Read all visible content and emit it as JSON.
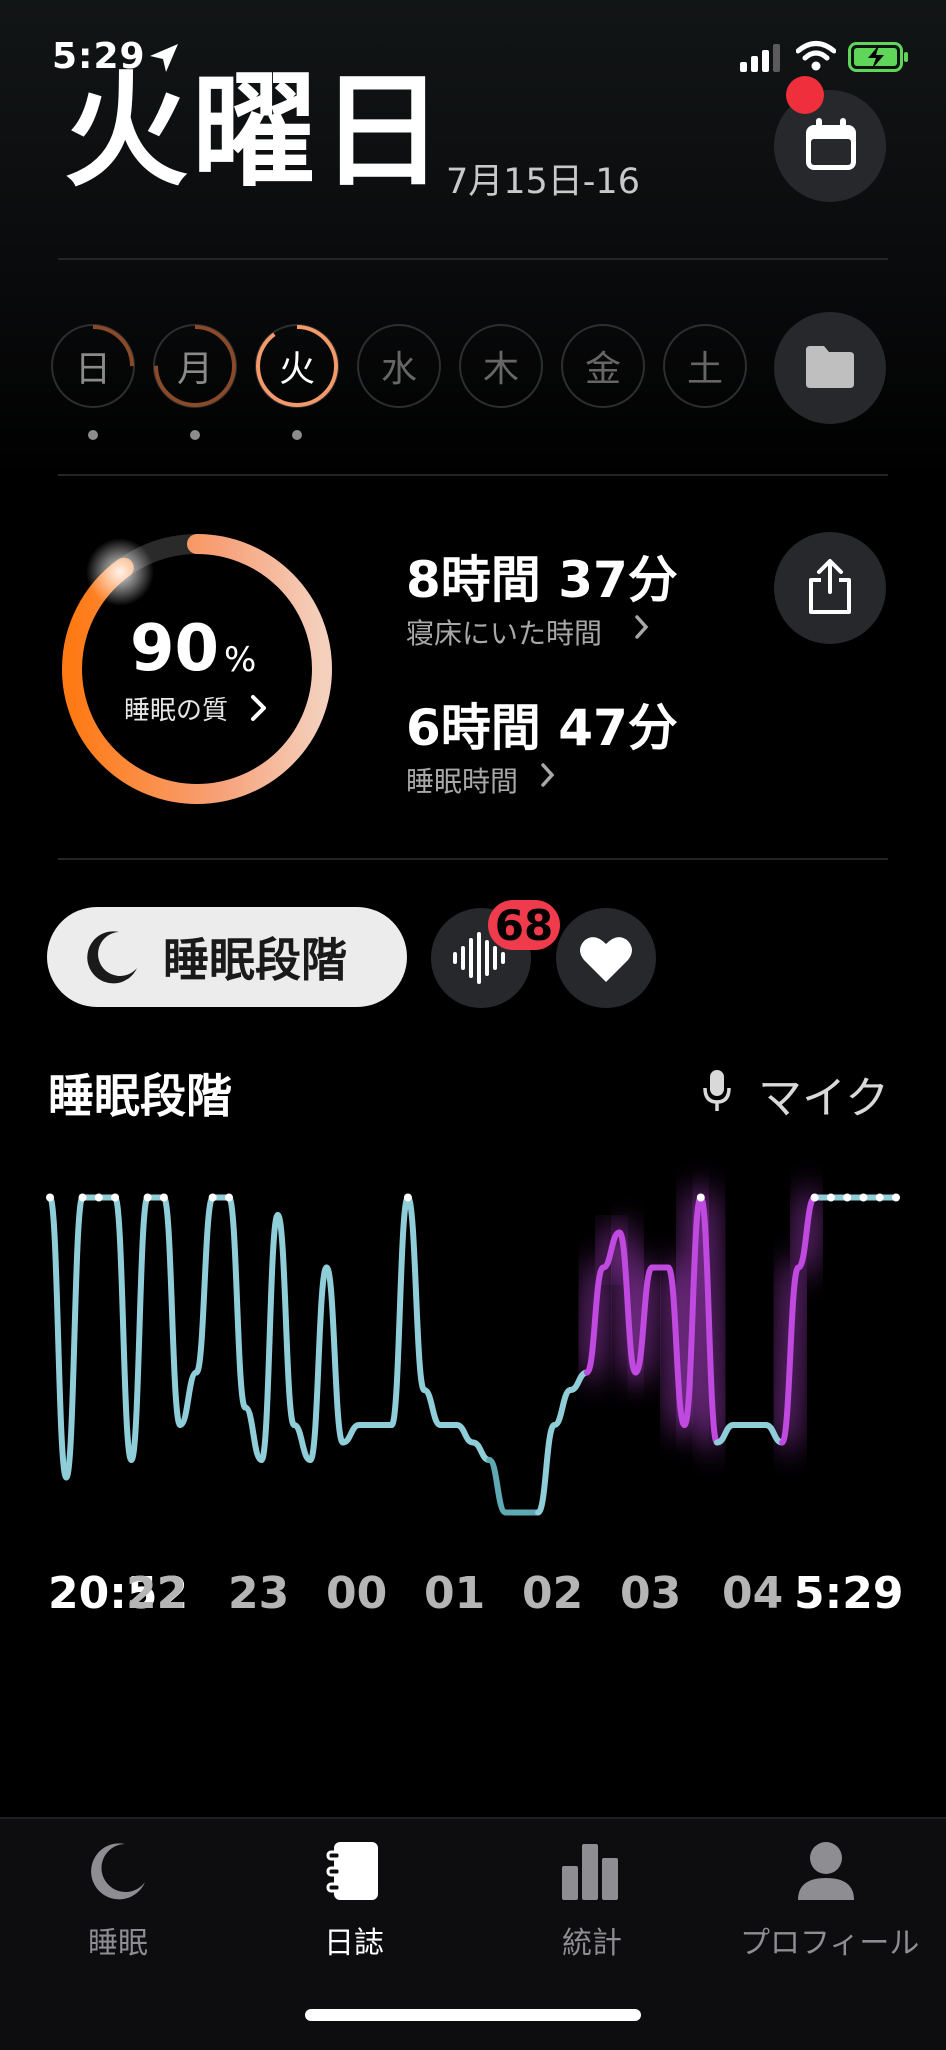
{
  "status_bar": {
    "time": "5:29"
  },
  "header": {
    "weekday": "火曜日",
    "date_range": "7月15日-16"
  },
  "week": {
    "days": [
      {
        "label": "日",
        "progress": 0.25,
        "dot": true
      },
      {
        "label": "月",
        "progress": 0.75,
        "dot": true
      },
      {
        "label": "火",
        "progress": 0.9,
        "dot": true
      },
      {
        "label": "水",
        "progress": 0,
        "dot": false
      },
      {
        "label": "木",
        "progress": 0,
        "dot": false
      },
      {
        "label": "金",
        "progress": 0,
        "dot": false
      },
      {
        "label": "土",
        "progress": 0,
        "dot": false
      }
    ],
    "selected": 2
  },
  "summary": {
    "quality_value": "90",
    "quality_unit": "%",
    "quality_label": "睡眠の質",
    "quality_fraction": 0.9,
    "time_in_bed": "8時間 37分",
    "time_in_bed_label": "寝床にいた時間",
    "sleep_time": "6時間 47分",
    "sleep_time_label": "睡眠時間"
  },
  "tabs": {
    "sleep_stage_label": "睡眠段階",
    "sound_badge": "68"
  },
  "chart": {
    "title": "睡眠段階",
    "mic_label": "マイク"
  },
  "chart_data": {
    "type": "line",
    "x": [
      "20:52",
      "21:00",
      "21:10",
      "21:20",
      "21:30",
      "21:40",
      "21:50",
      "22:00",
      "22:10",
      "22:20",
      "22:30",
      "22:40",
      "22:50",
      "23:00",
      "23:10",
      "23:20",
      "23:30",
      "23:40",
      "23:50",
      "00:00",
      "00:10",
      "00:20",
      "00:30",
      "00:40",
      "00:50",
      "01:00",
      "01:10",
      "01:20",
      "01:30",
      "01:40",
      "01:50",
      "02:00",
      "02:10",
      "02:20",
      "02:30",
      "02:40",
      "02:50",
      "03:00",
      "03:10",
      "03:20",
      "03:30",
      "03:40",
      "03:50",
      "04:00",
      "04:10",
      "04:20",
      "04:30",
      "04:40",
      "04:50",
      "05:00",
      "05:10",
      "05:20",
      "05:29"
    ],
    "y": [
      0.95,
      0.15,
      0.95,
      0.95,
      0.95,
      0.2,
      0.95,
      0.95,
      0.3,
      0.45,
      0.95,
      0.95,
      0.35,
      0.2,
      0.9,
      0.3,
      0.2,
      0.75,
      0.25,
      0.3,
      0.3,
      0.3,
      0.95,
      0.4,
      0.3,
      0.3,
      0.25,
      0.2,
      0.05,
      0.05,
      0.05,
      0.3,
      0.4,
      0.45,
      0.75,
      0.85,
      0.45,
      0.75,
      0.75,
      0.3,
      0.95,
      0.25,
      0.3,
      0.3,
      0.3,
      0.25,
      0.75,
      0.95,
      0.95,
      0.95,
      0.95,
      0.95,
      0.95
    ],
    "x_ticks": [
      "20:52",
      "22",
      "23",
      "00",
      "01",
      "02",
      "03",
      "04",
      "5:29"
    ],
    "colors": {
      "deep": "#5fa9b4",
      "light": "#8fcdd8",
      "rem": "#c04adf",
      "awake": "#ffffff"
    }
  },
  "tabbar": {
    "items": [
      {
        "label": "睡眠",
        "active": false
      },
      {
        "label": "日誌",
        "active": true
      },
      {
        "label": "統計",
        "active": false
      },
      {
        "label": "プロフィール",
        "active": false
      }
    ]
  }
}
